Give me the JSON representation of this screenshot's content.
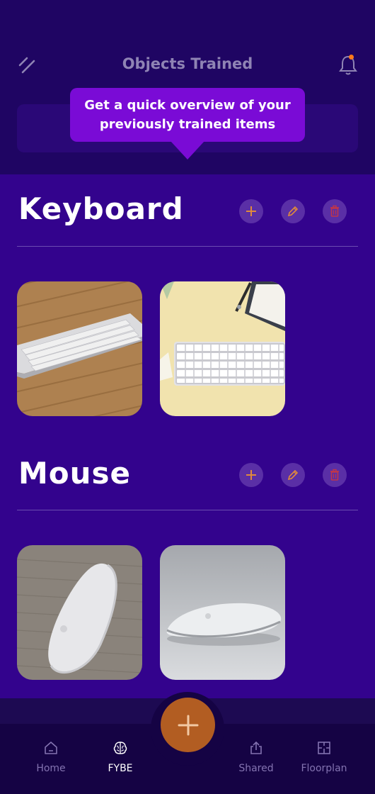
{
  "header": {
    "title": "Objects Trained",
    "menu_icon": "diagonal-lines-icon",
    "notification_icon": "bell-icon"
  },
  "tooltip": {
    "line1": "Get a quick overview of your",
    "line2": "previously trained items"
  },
  "sections": [
    {
      "title": "Keyboard",
      "actions": [
        "add-icon",
        "edit-pencil-icon",
        "delete-trash-icon"
      ],
      "images": [
        "keyboard-on-wooden-desk",
        "keyboard-on-yellow-desk"
      ]
    },
    {
      "title": "Mouse",
      "actions": [
        "add-icon",
        "edit-pencil-icon",
        "delete-trash-icon"
      ],
      "images": [
        "mouse-on-wood-texture",
        "mouse-on-grey-background"
      ]
    }
  ],
  "nav": {
    "items": [
      {
        "label": "Home",
        "icon": "home-icon",
        "active": false
      },
      {
        "label": "FYBE",
        "icon": "brain-icon",
        "active": true
      },
      {
        "label": "Shared",
        "icon": "share-icon",
        "active": false
      },
      {
        "label": "Floorplan",
        "icon": "floorplan-icon",
        "active": false
      }
    ],
    "fab_icon": "plus-icon"
  },
  "colors": {
    "background": "#33038d",
    "tooltip": "#7a0bd6",
    "accent": "#b25d22",
    "icon_orange": "#e08a3c",
    "icon_red": "#c0364a"
  }
}
